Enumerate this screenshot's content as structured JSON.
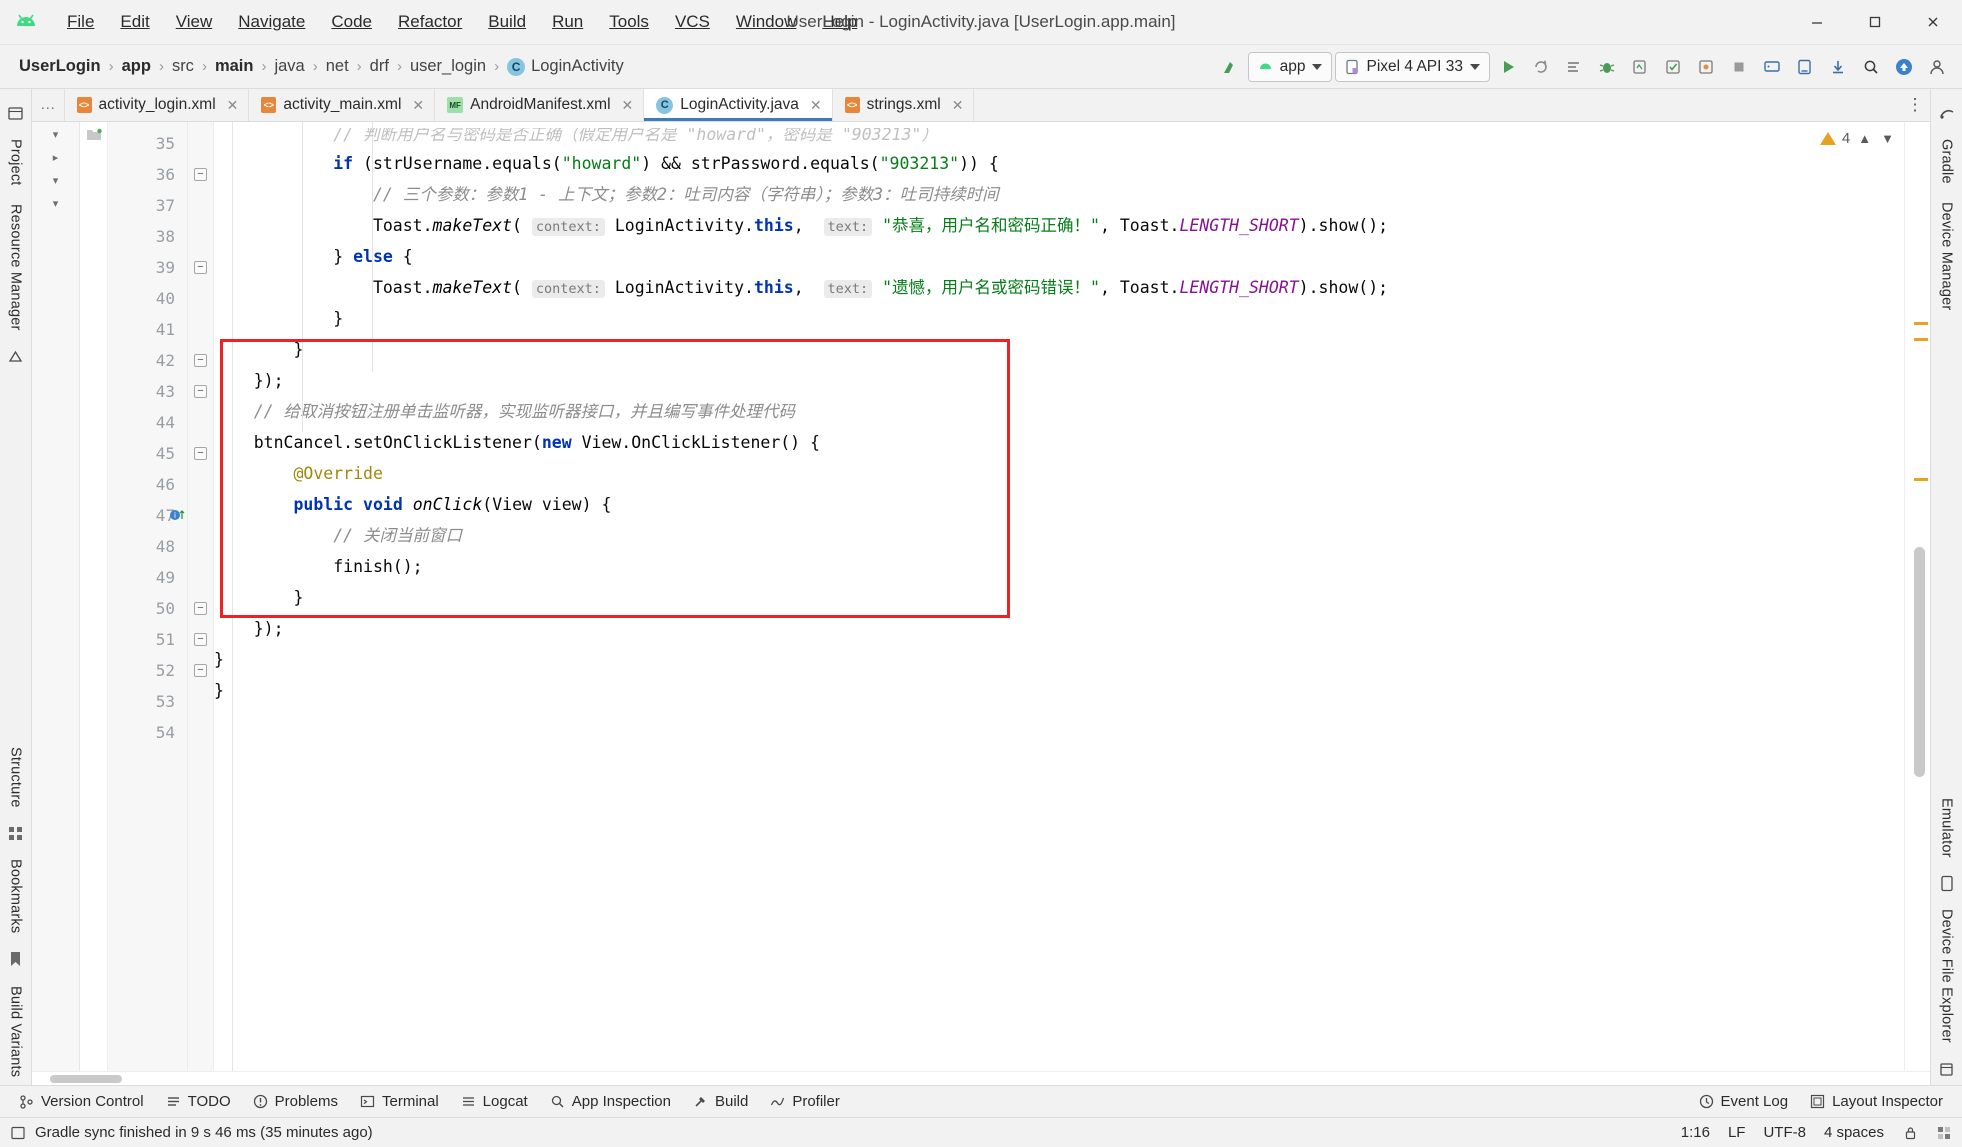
{
  "window": {
    "title": "UserLogin - LoginActivity.java [UserLogin.app.main]",
    "minimize": "−",
    "maximize": "□",
    "close": "✕"
  },
  "menu": {
    "items": [
      {
        "label": "File",
        "mnemonic": "F"
      },
      {
        "label": "Edit",
        "mnemonic": "E"
      },
      {
        "label": "View",
        "mnemonic": "V"
      },
      {
        "label": "Navigate",
        "mnemonic": "N"
      },
      {
        "label": "Code",
        "mnemonic": "C"
      },
      {
        "label": "Refactor",
        "mnemonic": "R"
      },
      {
        "label": "Build",
        "mnemonic": "B"
      },
      {
        "label": "Run",
        "mnemonic": "u"
      },
      {
        "label": "Tools",
        "mnemonic": "T"
      },
      {
        "label": "VCS",
        "mnemonic": "S"
      },
      {
        "label": "Window",
        "mnemonic": "W"
      },
      {
        "label": "Help",
        "mnemonic": "H"
      }
    ]
  },
  "breadcrumb": {
    "items": [
      {
        "label": "UserLogin",
        "bold": true
      },
      {
        "label": "app",
        "bold": true
      },
      {
        "label": "src",
        "bold": false
      },
      {
        "label": "main",
        "bold": true
      },
      {
        "label": "java",
        "bold": false
      },
      {
        "label": "net",
        "bold": false
      },
      {
        "label": "drf",
        "bold": false
      },
      {
        "label": "user_login",
        "bold": false
      },
      {
        "label": "LoginActivity",
        "bold": false,
        "icon": "class-icon",
        "icon_char": "C"
      }
    ],
    "separator": "›"
  },
  "toolbar": {
    "module_selector": "app",
    "device_selector": "Pixel 4 API 33",
    "icons": [
      "run-icon",
      "rerun-icon",
      "run-with-coverage-icon",
      "debug-icon",
      "profile-icon",
      "apply-changes-icon",
      "apply-code-changes-icon",
      "stop-icon",
      "avd-manager-icon",
      "sdk-manager-icon",
      "download-icon",
      "search-everywhere-icon",
      "update-icon",
      "account-icon"
    ]
  },
  "tabs": [
    {
      "label": "activity_login.xml",
      "icon": "xml-layout-icon",
      "icon_char": "<>",
      "active": false
    },
    {
      "label": "activity_main.xml",
      "icon": "xml-layout-icon",
      "icon_char": "<>",
      "active": false
    },
    {
      "label": "AndroidManifest.xml",
      "icon": "manifest-icon",
      "icon_char": "MF",
      "active": false
    },
    {
      "label": "LoginActivity.java",
      "icon": "java-class-icon",
      "icon_char": "C",
      "active": true
    },
    {
      "label": "strings.xml",
      "icon": "xml-values-icon",
      "icon_char": "<>",
      "active": false
    }
  ],
  "tabs_overflow_icon": "⋮",
  "left_rail": {
    "top": [
      "Project"
    ],
    "mid": [
      "Resource Manager"
    ],
    "bottom": [
      "Structure",
      "Bookmarks",
      "Build Variants"
    ]
  },
  "right_rail": {
    "top": [
      "Gradle",
      "Device Manager"
    ],
    "bottom": [
      "Emulator",
      "Device File Explorer"
    ]
  },
  "editor": {
    "first_line_number": 35,
    "warning_count": "4",
    "warning_icon": "warning-triangle-icon",
    "lines": [
      {
        "num": 35,
        "clipped": true,
        "html": "            <span class='cm'>// 判断用户名与密码是否正确（假定用户名是 \"howard\"，密码是 \"903213\"）</span>"
      },
      {
        "num": 36,
        "fold": "minus",
        "html": "            <span class='k'>if</span> (strUsername.equals(<span class='s'>\"howard\"</span>) &amp;&amp; strPassword.equals(<span class='s'>\"903213\"</span>)) {"
      },
      {
        "num": 37,
        "html": "                <span class='cm'>// 三个参数：参数1 - 上下文；参数2：吐司内容（字符串）；参数3：吐司持续时间</span>"
      },
      {
        "num": 38,
        "html": "                Toast.<span class='f'>makeText</span>( <span class='hint'>context:</span> LoginActivity.<span class='k'>this</span>,  <span class='hint'>text:</span> <span class='s'>\"恭喜，用户名和密码正确！\"</span>, Toast.<span class='st'>LENGTH_SHORT</span>).show();"
      },
      {
        "num": 39,
        "fold": "minus",
        "html": "            } <span class='k'>else</span> {"
      },
      {
        "num": 40,
        "html": "                Toast.<span class='f'>makeText</span>( <span class='hint'>context:</span> LoginActivity.<span class='k'>this</span>,  <span class='hint'>text:</span> <span class='s'>\"遗憾，用户名或密码错误！\"</span>, Toast.<span class='st'>LENGTH_SHORT</span>).show();"
      },
      {
        "num": 41,
        "html": "            }"
      },
      {
        "num": 42,
        "fold": "minus",
        "html": "        }"
      },
      {
        "num": 43,
        "fold": "minus",
        "html": "    });"
      },
      {
        "num": 44,
        "html": "    <span class='cm'>// 给取消按钮注册单击监听器，实现监听器接口，并且编写事件处理代码</span>"
      },
      {
        "num": 45,
        "fold": "minus",
        "html": "    btnCancel.setOnClickListener(<span class='k'>new</span> View.OnClickListener() {"
      },
      {
        "num": 46,
        "html": "        <span class='anno'>@Override</span>"
      },
      {
        "num": 47,
        "gutter_icon": "implementing-method-icon",
        "html": "        <span class='k'>public</span> <span class='k'>void</span> <span class='f'>onClick</span>(View view) {"
      },
      {
        "num": 48,
        "html": "            <span class='cm'>// 关闭当前窗口</span>"
      },
      {
        "num": 49,
        "html": "            finish();"
      },
      {
        "num": 50,
        "fold": "minus",
        "html": "        }"
      },
      {
        "num": 51,
        "fold": "minus",
        "html": "    });"
      },
      {
        "num": 52,
        "fold": "minus",
        "html": "}"
      },
      {
        "num": 53,
        "html": "}"
      },
      {
        "num": 54,
        "html": ""
      }
    ],
    "highlight_box": {
      "color": "#ec2224",
      "label": "cancel-button-listener-highlight"
    }
  },
  "bottom_tools": [
    {
      "label": "Version Control",
      "icon": "version-control-icon"
    },
    {
      "label": "TODO",
      "icon": "todo-icon"
    },
    {
      "label": "Problems",
      "icon": "problems-icon"
    },
    {
      "label": "Terminal",
      "icon": "terminal-icon"
    },
    {
      "label": "Logcat",
      "icon": "logcat-icon"
    },
    {
      "label": "App Inspection",
      "icon": "app-inspection-icon"
    },
    {
      "label": "Build",
      "icon": "build-hammer-icon"
    },
    {
      "label": "Profiler",
      "icon": "profiler-icon"
    }
  ],
  "bottom_tools_right": [
    {
      "label": "Event Log",
      "icon": "event-log-icon"
    },
    {
      "label": "Layout Inspector",
      "icon": "layout-inspector-icon"
    }
  ],
  "status": {
    "message": "Gradle sync finished in 9 s 46 ms (35 minutes ago)",
    "message_icon": "gradle-sync-icon",
    "caret_position": "1:16",
    "line_separator": "LF",
    "encoding": "UTF-8",
    "indent": "4 spaces",
    "right_icons": [
      "lock-icon",
      "inspection-icon"
    ]
  },
  "colors": {
    "accent_blue": "#3d7ab8",
    "highlight_red": "#ec2224",
    "android_green": "#3ddc84",
    "keyword": "#0033b3",
    "string": "#067d17",
    "comment": "#8c8c8c",
    "static_field": "#871094",
    "annotation": "#9e880d",
    "warning": "#e5a320"
  }
}
